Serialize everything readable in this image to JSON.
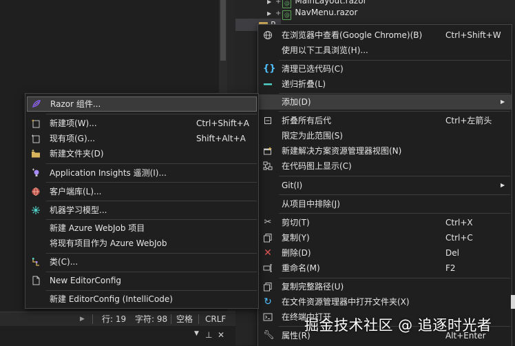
{
  "explorer": {
    "rows": [
      {
        "label": "MainLayout.razor",
        "expanded": false
      },
      {
        "label": "NavMenu.razor",
        "expanded": false
      },
      {
        "label": "P...",
        "expanded": true
      }
    ]
  },
  "context_menu": {
    "items": [
      {
        "label": "在浏览器中查看(Google Chrome)(B)",
        "shortcut": "Ctrl+Shift+W",
        "icon": "globe-icon"
      },
      {
        "label": "使用以下工具浏览(H)...",
        "shortcut": "",
        "icon": ""
      },
      {
        "label": "清理已选代码(C)",
        "shortcut": "",
        "icon": "braces-icon"
      },
      {
        "label": "递归折叠(L)",
        "shortcut": "",
        "icon": "collapse-bar-icon"
      },
      {
        "label": "添加(D)",
        "shortcut": "",
        "icon": "",
        "submenu": true
      },
      {
        "label": "折叠所有后代",
        "shortcut": "Ctrl+左箭头",
        "icon": "collapse-all-icon"
      },
      {
        "label": "限定为此范围(S)",
        "shortcut": "",
        "icon": ""
      },
      {
        "label": "新建解决方案资源管理器视图(N)",
        "shortcut": "",
        "icon": "new-explorer-view-icon"
      },
      {
        "label": "在代码图上显示(C)",
        "shortcut": "",
        "icon": "code-map-icon"
      },
      {
        "label": "Git(I)",
        "shortcut": "",
        "icon": "",
        "submenu": true
      },
      {
        "label": "从项目中排除(J)",
        "shortcut": "",
        "icon": ""
      },
      {
        "label": "剪切(T)",
        "shortcut": "Ctrl+X",
        "icon": "scissors-icon"
      },
      {
        "label": "复制(Y)",
        "shortcut": "Ctrl+C",
        "icon": "copy-icon"
      },
      {
        "label": "删除(D)",
        "shortcut": "Del",
        "icon": "delete-x-icon"
      },
      {
        "label": "重命名(M)",
        "shortcut": "F2",
        "icon": "rename-icon"
      },
      {
        "label": "复制完整路径(U)",
        "shortcut": "",
        "icon": "copy-path-icon"
      },
      {
        "label": "在文件资源管理器中打开文件夹(X)",
        "shortcut": "",
        "icon": "open-folder-arrow-icon"
      },
      {
        "label": "在终端中打开",
        "shortcut": "",
        "icon": "terminal-icon"
      },
      {
        "label": "属性(R)",
        "shortcut": "Alt+Enter",
        "icon": "wrench-icon"
      }
    ]
  },
  "add_submenu": {
    "items": [
      {
        "label": "Razor 组件...",
        "shortcut": "",
        "icon": "razor-component-icon"
      },
      {
        "label": "新建项(W)...",
        "shortcut": "Ctrl+Shift+A",
        "icon": "new-item-icon"
      },
      {
        "label": "现有项(G)...",
        "shortcut": "Shift+Alt+A",
        "icon": "existing-item-icon"
      },
      {
        "label": "新建文件夹(D)",
        "shortcut": "",
        "icon": "new-folder-icon"
      },
      {
        "label": "Application Insights 遥测(I)...",
        "shortcut": "",
        "icon": "lightbulb-icon"
      },
      {
        "label": "客户端库(L)...",
        "shortcut": "",
        "icon": "client-library-icon"
      },
      {
        "label": "机器学习模型...",
        "shortcut": "",
        "icon": "ml-model-icon"
      },
      {
        "label": "新建 Azure WebJob 项目",
        "shortcut": "",
        "icon": ""
      },
      {
        "label": "将现有项目作为 Azure WebJob",
        "shortcut": "",
        "icon": ""
      },
      {
        "label": "类(C)...",
        "shortcut": "",
        "icon": "class-icon"
      },
      {
        "label": "New EditorConfig",
        "shortcut": "",
        "icon": "document-icon"
      },
      {
        "label": "新建 EditorConfig (IntelliCode)",
        "shortcut": "",
        "icon": ""
      }
    ]
  },
  "status_bar": {
    "line": "行: 19",
    "column": "字符: 98",
    "whitespace": "空格",
    "line_ending": "CRLF"
  },
  "watermark": "掘金技术社区 @ 追逐时光者",
  "colors": {
    "menu_bg": "#1f1f1f",
    "menu_highlight": "#3d3d3d",
    "razor_purple": "#8b5cf6",
    "delete_red": "#e05555",
    "braces_cyan": "#4fc1ff"
  }
}
